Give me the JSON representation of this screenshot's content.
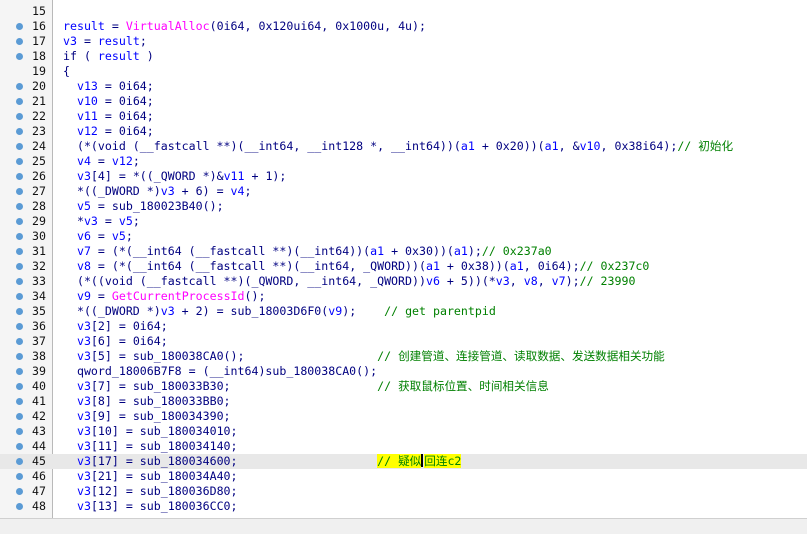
{
  "editor": {
    "lines": [
      {
        "num": "15",
        "dot": false,
        "parts": []
      },
      {
        "num": "16",
        "dot": true,
        "parts": [
          {
            "t": "var",
            "s": "result"
          },
          {
            "t": "",
            "s": " = "
          },
          {
            "t": "fn",
            "s": "VirtualAlloc"
          },
          {
            "t": "",
            "s": "(0i64, 0x120ui64, 0x1000u, 4u);"
          }
        ]
      },
      {
        "num": "17",
        "dot": true,
        "parts": [
          {
            "t": "var",
            "s": "v3"
          },
          {
            "t": "",
            "s": " = "
          },
          {
            "t": "var",
            "s": "result"
          },
          {
            "t": "",
            "s": ";"
          }
        ]
      },
      {
        "num": "18",
        "dot": true,
        "parts": [
          {
            "t": "",
            "s": "if ( "
          },
          {
            "t": "var",
            "s": "result"
          },
          {
            "t": "",
            "s": " )"
          }
        ]
      },
      {
        "num": "19",
        "dot": false,
        "parts": [
          {
            "t": "",
            "s": "{"
          }
        ]
      },
      {
        "num": "20",
        "dot": true,
        "parts": [
          {
            "t": "",
            "s": "  "
          },
          {
            "t": "var",
            "s": "v13"
          },
          {
            "t": "",
            "s": " = 0i64;"
          }
        ]
      },
      {
        "num": "21",
        "dot": true,
        "parts": [
          {
            "t": "",
            "s": "  "
          },
          {
            "t": "var",
            "s": "v10"
          },
          {
            "t": "",
            "s": " = 0i64;"
          }
        ]
      },
      {
        "num": "22",
        "dot": true,
        "parts": [
          {
            "t": "",
            "s": "  "
          },
          {
            "t": "var",
            "s": "v11"
          },
          {
            "t": "",
            "s": " = 0i64;"
          }
        ]
      },
      {
        "num": "23",
        "dot": true,
        "parts": [
          {
            "t": "",
            "s": "  "
          },
          {
            "t": "var",
            "s": "v12"
          },
          {
            "t": "",
            "s": " = 0i64;"
          }
        ]
      },
      {
        "num": "24",
        "dot": true,
        "parts": [
          {
            "t": "",
            "s": "  (*(void (__fastcall **)(__int64, __int128 *, __int64))("
          },
          {
            "t": "var",
            "s": "a1"
          },
          {
            "t": "",
            "s": " + 0x20))("
          },
          {
            "t": "var",
            "s": "a1"
          },
          {
            "t": "",
            "s": ", &"
          },
          {
            "t": "var",
            "s": "v10"
          },
          {
            "t": "",
            "s": ", 0x38i64);"
          },
          {
            "t": "cm",
            "s": "// 初始化"
          }
        ]
      },
      {
        "num": "25",
        "dot": true,
        "parts": [
          {
            "t": "",
            "s": "  "
          },
          {
            "t": "var",
            "s": "v4"
          },
          {
            "t": "",
            "s": " = "
          },
          {
            "t": "var",
            "s": "v12"
          },
          {
            "t": "",
            "s": ";"
          }
        ]
      },
      {
        "num": "26",
        "dot": true,
        "parts": [
          {
            "t": "",
            "s": "  "
          },
          {
            "t": "var",
            "s": "v3"
          },
          {
            "t": "",
            "s": "[4] = *((_QWORD *)&"
          },
          {
            "t": "var",
            "s": "v11"
          },
          {
            "t": "",
            "s": " + 1);"
          }
        ]
      },
      {
        "num": "27",
        "dot": true,
        "parts": [
          {
            "t": "",
            "s": "  *((_DWORD *)"
          },
          {
            "t": "var",
            "s": "v3"
          },
          {
            "t": "",
            "s": " + 6) = "
          },
          {
            "t": "var",
            "s": "v4"
          },
          {
            "t": "",
            "s": ";"
          }
        ]
      },
      {
        "num": "28",
        "dot": true,
        "parts": [
          {
            "t": "",
            "s": "  "
          },
          {
            "t": "var",
            "s": "v5"
          },
          {
            "t": "",
            "s": " = sub_180023B40();"
          }
        ]
      },
      {
        "num": "29",
        "dot": true,
        "parts": [
          {
            "t": "",
            "s": "  *"
          },
          {
            "t": "var",
            "s": "v3"
          },
          {
            "t": "",
            "s": " = "
          },
          {
            "t": "var",
            "s": "v5"
          },
          {
            "t": "",
            "s": ";"
          }
        ]
      },
      {
        "num": "30",
        "dot": true,
        "parts": [
          {
            "t": "",
            "s": "  "
          },
          {
            "t": "var",
            "s": "v6"
          },
          {
            "t": "",
            "s": " = "
          },
          {
            "t": "var",
            "s": "v5"
          },
          {
            "t": "",
            "s": ";"
          }
        ]
      },
      {
        "num": "31",
        "dot": true,
        "parts": [
          {
            "t": "",
            "s": "  "
          },
          {
            "t": "var",
            "s": "v7"
          },
          {
            "t": "",
            "s": " = (*(__int64 (__fastcall **)(__int64))("
          },
          {
            "t": "var",
            "s": "a1"
          },
          {
            "t": "",
            "s": " + 0x30))("
          },
          {
            "t": "var",
            "s": "a1"
          },
          {
            "t": "",
            "s": ");"
          },
          {
            "t": "cm",
            "s": "// 0x237a0"
          }
        ]
      },
      {
        "num": "32",
        "dot": true,
        "parts": [
          {
            "t": "",
            "s": "  "
          },
          {
            "t": "var",
            "s": "v8"
          },
          {
            "t": "",
            "s": " = (*(__int64 (__fastcall **)(__int64, _QWORD))("
          },
          {
            "t": "var",
            "s": "a1"
          },
          {
            "t": "",
            "s": " + 0x38))("
          },
          {
            "t": "var",
            "s": "a1"
          },
          {
            "t": "",
            "s": ", 0i64);"
          },
          {
            "t": "cm",
            "s": "// 0x237c0"
          }
        ]
      },
      {
        "num": "33",
        "dot": true,
        "parts": [
          {
            "t": "",
            "s": "  (*((void (__fastcall **)(_QWORD, __int64, _QWORD))"
          },
          {
            "t": "var",
            "s": "v6"
          },
          {
            "t": "",
            "s": " + 5))(*"
          },
          {
            "t": "var",
            "s": "v3"
          },
          {
            "t": "",
            "s": ", "
          },
          {
            "t": "var",
            "s": "v8"
          },
          {
            "t": "",
            "s": ", "
          },
          {
            "t": "var",
            "s": "v7"
          },
          {
            "t": "",
            "s": ");"
          },
          {
            "t": "cm",
            "s": "// 23990"
          }
        ]
      },
      {
        "num": "34",
        "dot": true,
        "parts": [
          {
            "t": "",
            "s": "  "
          },
          {
            "t": "var",
            "s": "v9"
          },
          {
            "t": "",
            "s": " = "
          },
          {
            "t": "fn",
            "s": "GetCurrentProcessId"
          },
          {
            "t": "",
            "s": "();"
          }
        ]
      },
      {
        "num": "35",
        "dot": true,
        "parts": [
          {
            "t": "",
            "s": "  *((_DWORD *)"
          },
          {
            "t": "var",
            "s": "v3"
          },
          {
            "t": "",
            "s": " + 2) = sub_18003D6F0("
          },
          {
            "t": "var",
            "s": "v9"
          },
          {
            "t": "",
            "s": ");    "
          },
          {
            "t": "cm",
            "s": "// get parentpid"
          }
        ]
      },
      {
        "num": "36",
        "dot": true,
        "parts": [
          {
            "t": "",
            "s": "  "
          },
          {
            "t": "var",
            "s": "v3"
          },
          {
            "t": "",
            "s": "[2] = 0i64;"
          }
        ]
      },
      {
        "num": "37",
        "dot": true,
        "parts": [
          {
            "t": "",
            "s": "  "
          },
          {
            "t": "var",
            "s": "v3"
          },
          {
            "t": "",
            "s": "[6] = 0i64;"
          }
        ]
      },
      {
        "num": "38",
        "dot": true,
        "parts": [
          {
            "t": "",
            "s": "  "
          },
          {
            "t": "var",
            "s": "v3"
          },
          {
            "t": "",
            "s": "[5] = sub_180038CA0();                   "
          },
          {
            "t": "cm",
            "s": "// 创建管道、连接管道、读取数据、发送数据相关功能"
          }
        ]
      },
      {
        "num": "39",
        "dot": true,
        "parts": [
          {
            "t": "",
            "s": "  qword_18006B7F8 = (__int64)sub_180038CA0();"
          }
        ]
      },
      {
        "num": "40",
        "dot": true,
        "parts": [
          {
            "t": "",
            "s": "  "
          },
          {
            "t": "var",
            "s": "v3"
          },
          {
            "t": "",
            "s": "[7] = sub_180033B30;                     "
          },
          {
            "t": "cm",
            "s": "// 获取鼠标位置、时间相关信息"
          }
        ]
      },
      {
        "num": "41",
        "dot": true,
        "parts": [
          {
            "t": "",
            "s": "  "
          },
          {
            "t": "var",
            "s": "v3"
          },
          {
            "t": "",
            "s": "[8] = sub_180033BB0;"
          }
        ]
      },
      {
        "num": "42",
        "dot": true,
        "parts": [
          {
            "t": "",
            "s": "  "
          },
          {
            "t": "var",
            "s": "v3"
          },
          {
            "t": "",
            "s": "[9] = sub_180034390;"
          }
        ]
      },
      {
        "num": "43",
        "dot": true,
        "parts": [
          {
            "t": "",
            "s": "  "
          },
          {
            "t": "var",
            "s": "v3"
          },
          {
            "t": "",
            "s": "[10] = sub_180034010;"
          }
        ]
      },
      {
        "num": "44",
        "dot": true,
        "parts": [
          {
            "t": "",
            "s": "  "
          },
          {
            "t": "var",
            "s": "v3"
          },
          {
            "t": "",
            "s": "[11] = sub_180034140;"
          }
        ]
      },
      {
        "num": "45",
        "dot": true,
        "current": true,
        "parts": [
          {
            "t": "",
            "s": "  "
          },
          {
            "t": "var",
            "s": "v3"
          },
          {
            "t": "",
            "s": "[17] = sub_180034600;                    "
          },
          {
            "t": "hlA",
            "s": "// 疑似"
          },
          {
            "t": "caret",
            "s": ""
          },
          {
            "t": "hlB",
            "s": "回连c2"
          }
        ]
      },
      {
        "num": "46",
        "dot": true,
        "parts": [
          {
            "t": "",
            "s": "  "
          },
          {
            "t": "var",
            "s": "v3"
          },
          {
            "t": "",
            "s": "[21] = sub_180034A40;"
          }
        ]
      },
      {
        "num": "47",
        "dot": true,
        "parts": [
          {
            "t": "",
            "s": "  "
          },
          {
            "t": "var",
            "s": "v3"
          },
          {
            "t": "",
            "s": "[12] = sub_180036D80;"
          }
        ]
      },
      {
        "num": "48",
        "dot": true,
        "parts": [
          {
            "t": "",
            "s": "  "
          },
          {
            "t": "var",
            "s": "v3"
          },
          {
            "t": "",
            "s": "[13] = sub_180036CC0;"
          }
        ]
      }
    ]
  }
}
